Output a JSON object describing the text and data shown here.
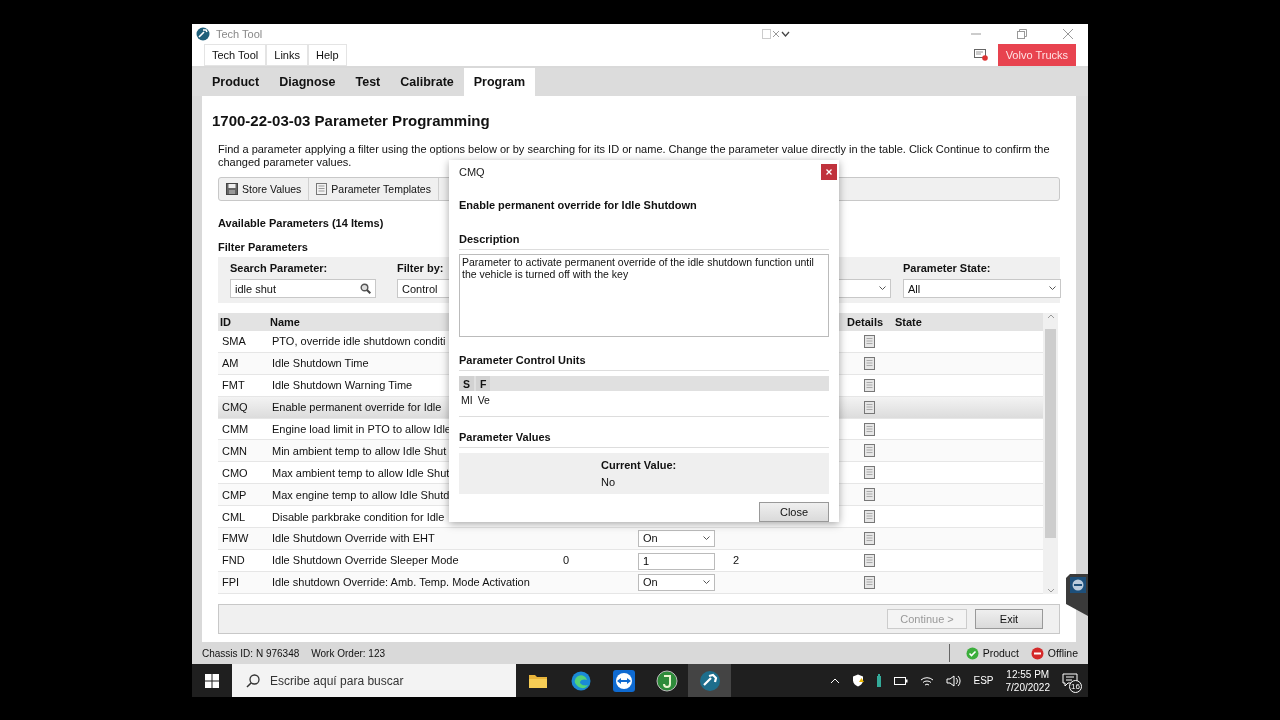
{
  "window": {
    "title": "Tech Tool"
  },
  "menu": [
    {
      "label": "Tech Tool"
    },
    {
      "label": "Links"
    },
    {
      "label": "Help"
    }
  ],
  "brand": "Volvo Trucks",
  "tabs": [
    {
      "label": "Product",
      "selected": false
    },
    {
      "label": "Diagnose",
      "selected": false
    },
    {
      "label": "Test",
      "selected": false
    },
    {
      "label": "Calibrate",
      "selected": false
    },
    {
      "label": "Program",
      "selected": true
    }
  ],
  "page": {
    "title": "1700-22-03-03 Parameter Programming",
    "intro": "Find a parameter applying a filter using the options below or by searching for its ID or name. Change the parameter value directly in the table. Click Continue to confirm the changed parameter values."
  },
  "toolbar": [
    {
      "label": "Store Values",
      "kind": "save"
    },
    {
      "label": "Parameter Templates",
      "kind": "template"
    }
  ],
  "available": "Available Parameters (14 Items)",
  "filter_title": "Filter Parameters",
  "filters": [
    {
      "label": "Search Parameter:",
      "value": "idle shut",
      "kind": "search"
    },
    {
      "label": "Filter by:",
      "value": "Control",
      "kind": "select"
    },
    {
      "kind": "select"
    },
    {
      "label": "Parameter State:",
      "value": "All",
      "kind": "select"
    }
  ],
  "table": {
    "columns": [
      "ID",
      "Name",
      "Details",
      "State"
    ],
    "rows": [
      {
        "id": "SMA",
        "name": "PTO, override idle shutdown conditi",
        "selected": false
      },
      {
        "id": "AM",
        "name": "Idle Shutdown Time",
        "selected": false
      },
      {
        "id": "FMT",
        "name": "Idle Shutdown Warning Time",
        "selected": false
      },
      {
        "id": "CMQ",
        "name": "Enable permanent override for Idle",
        "selected": true
      },
      {
        "id": "CMM",
        "name": "Engine load limit in PTO to allow Idle",
        "selected": false
      },
      {
        "id": "CMN",
        "name": "Min ambient temp to allow Idle Shut",
        "selected": false
      },
      {
        "id": "CMO",
        "name": "Max ambient temp to allow Idle Shut",
        "selected": false
      },
      {
        "id": "CMP",
        "name": "Max engine temp to allow Idle Shutd",
        "selected": false
      },
      {
        "id": "CML",
        "name": "Disable parkbrake condition for Idle",
        "selected": false
      },
      {
        "id": "FMW",
        "name": "Idle Shutdown  Override with EHT",
        "selected": false,
        "value": "On",
        "kind": "select"
      },
      {
        "id": "FND",
        "name": "Idle Shutdown Override Sleeper Mode",
        "selected": false,
        "min": "0",
        "value": "1",
        "kind": "input",
        "max": "2"
      },
      {
        "id": "FPI",
        "name": "Idle shutdown Override: Amb. Temp. Mode Activation",
        "selected": false,
        "value": "On",
        "kind": "select"
      }
    ]
  },
  "actions": [
    {
      "label": "Continue >",
      "disabled": true
    },
    {
      "label": "Exit",
      "disabled": false
    }
  ],
  "status_bar": {
    "left": [
      "Chassis ID: N 976348",
      "Work Order: 123"
    ],
    "indicators": [
      {
        "label": "Product",
        "kind": "ok"
      },
      {
        "label": "Offline",
        "kind": "offline"
      }
    ]
  },
  "dialog": {
    "title": "CMQ",
    "heading": "Enable permanent override for Idle Shutdown",
    "description_label": "Description",
    "description": "Parameter to activate permanent override of the idle shutdown function until the vehicle is turned off with the key",
    "units_label": "Parameter Control Units",
    "units_columns": [
      "S",
      "F"
    ],
    "units_row": [
      "MI",
      "Ve"
    ],
    "values_label": "Parameter Values",
    "current_label": "Current Value:",
    "current_value": "No",
    "close": "Close"
  },
  "taskbar": {
    "search_placeholder": "Escribe aquí para buscar",
    "apps": [
      {
        "kind": "folder",
        "selected": false
      },
      {
        "kind": "browser",
        "selected": false
      },
      {
        "kind": "remote",
        "selected": false
      },
      {
        "kind": "green",
        "selected": false
      },
      {
        "kind": "techtool",
        "selected": true
      }
    ],
    "language": "ESP",
    "time": "12:55 PM",
    "date": "7/20/2022",
    "notifications": "16"
  }
}
